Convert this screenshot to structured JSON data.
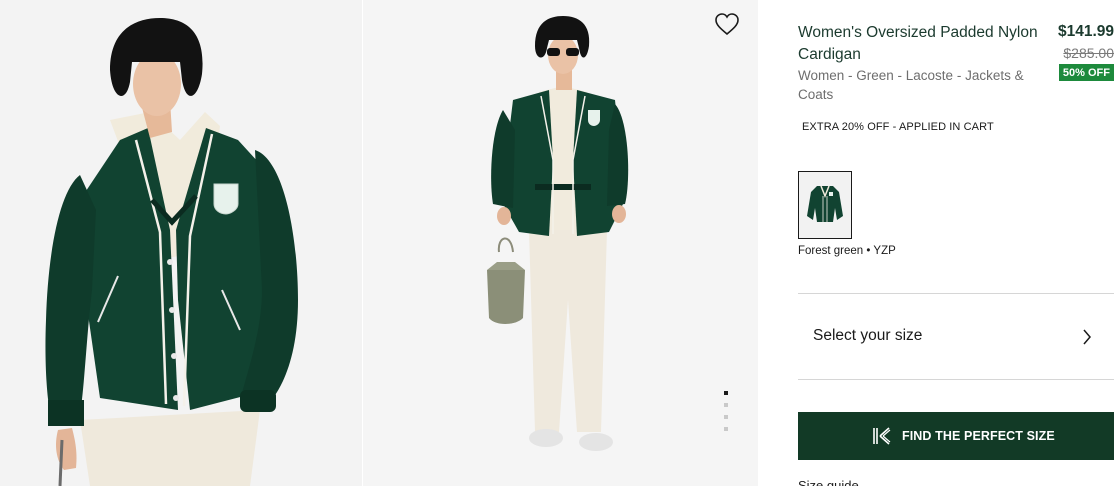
{
  "product": {
    "title": "Women's Oversized Padded Nylon Cardigan",
    "breadcrumb": "Women - Green - Lacoste - Jackets & Coats",
    "price": "$141.99",
    "original_price": "$285.00",
    "discount_badge": "50% OFF",
    "promo": "EXTRA 20% OFF - APPLIED IN CART"
  },
  "color": {
    "selected_label": "Forest green • YZP",
    "swatch_color": "#0f3d2c"
  },
  "size": {
    "select_label": "Select your size",
    "find_size_label": "FIND THE PERFECT SIZE",
    "guide_label": "Size guide"
  },
  "gallery": {
    "image_count": 4,
    "active_index": 0
  },
  "colors": {
    "brand_dark_green": "#123a26",
    "discount_green": "#1d8a3c",
    "jacket_green": "#114331"
  }
}
